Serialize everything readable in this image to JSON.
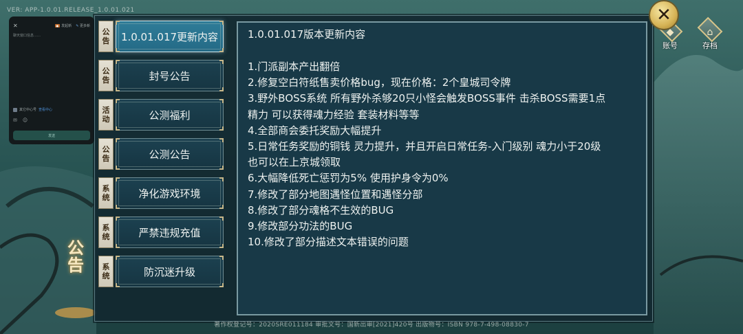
{
  "version": "VER: APP-1.0.01.RELEASE_1.0.01.021",
  "chat": {
    "close": "✕",
    "btn1": "发起新",
    "btn2": "更多新",
    "prompt": "聊天窗口信息……",
    "username": "其它中心号",
    "link": "查看中心",
    "send": "发送"
  },
  "menu": [
    {
      "tag": "公告",
      "label": "1.0.01.017更新内容",
      "active": true
    },
    {
      "tag": "公告",
      "label": "封号公告"
    },
    {
      "tag": "活动",
      "label": "公测福利"
    },
    {
      "tag": "公告",
      "label": "公测公告"
    },
    {
      "tag": "系统",
      "label": "净化游戏环境"
    },
    {
      "tag": "系统",
      "label": "严禁违规充值"
    },
    {
      "tag": "系统",
      "label": "防沉迷升级"
    }
  ],
  "content": {
    "title": "1.0.01.017版本更新内容",
    "lines": [
      "1.门派副本产出翻倍",
      "2.修复空白符纸售卖价格bug，现在价格：2个皇城司令牌",
      "3.野外BOSS系统 所有野外杀够20只小怪会触发BOSS事件  击杀BOSS需要1点",
      "精力 可以获得魂力经验 套装材料等等",
      "4.全部商会委托奖励大幅提升",
      "5.日常任务奖励的铜钱 灵力提升，并且开启日常任务-入门级别 魂力小于20级",
      "也可以在上京城领取",
      "6.大幅降低死亡惩罚为5%   使用护身令为0%",
      "7.修改了部分地图遇怪位置和遇怪分部",
      "8.修改了部分魂格不生效的BUG",
      "9.修改部分功法的BUG",
      "10.修改了部分描述文本错误的问题"
    ]
  },
  "controls": {
    "close": "✕",
    "account_label": "账号",
    "save_label": "存档"
  },
  "side_sign": "公告",
  "footer": "著作权登记号：2020SRE011184 审批文号：国新出审[2021]420号 出版物号：ISBN 978-7-498-08830-7"
}
